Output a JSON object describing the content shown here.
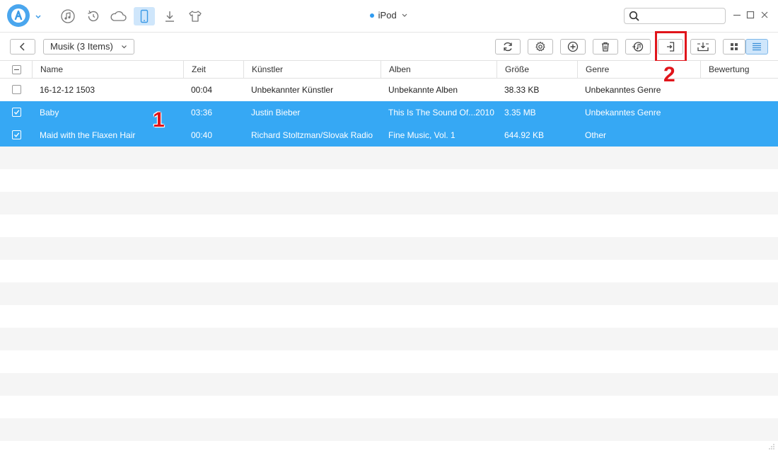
{
  "header": {
    "device_name": "iPod",
    "search_placeholder": ""
  },
  "nav": [
    "music-icon",
    "history-icon",
    "cloud-icon",
    "device-icon",
    "download-icon",
    "shirt-icon"
  ],
  "toolbar": {
    "category_label": "Musik (3 Items)"
  },
  "table": {
    "columns": [
      "Name",
      "Zeit",
      "Künstler",
      "Alben",
      "Größe",
      "Genre",
      "Bewertung"
    ],
    "rows": [
      {
        "name": "16-12-12 1503",
        "time": "00:04",
        "artist": "Unbekannter Künstler",
        "album": "Unbekannte Alben",
        "size": "38.33 KB",
        "genre": "Unbekanntes Genre",
        "rating": "",
        "checked": false
      },
      {
        "name": "Baby",
        "time": "03:36",
        "artist": "Justin Bieber",
        "album": "This Is The Sound Of...2010",
        "size": "3.35 MB",
        "genre": "Unbekanntes Genre",
        "rating": "",
        "checked": true
      },
      {
        "name": "Maid with the Flaxen Hair",
        "time": "00:40",
        "artist": "Richard Stoltzman/Slovak Radio",
        "album": "Fine Music, Vol. 1",
        "size": "644.92 KB",
        "genre": "Other",
        "rating": "",
        "checked": true
      }
    ]
  },
  "annotations": {
    "step1": "1",
    "step2": "2"
  },
  "colors": {
    "accent": "#36a8f4",
    "highlight": "#e0151b"
  }
}
